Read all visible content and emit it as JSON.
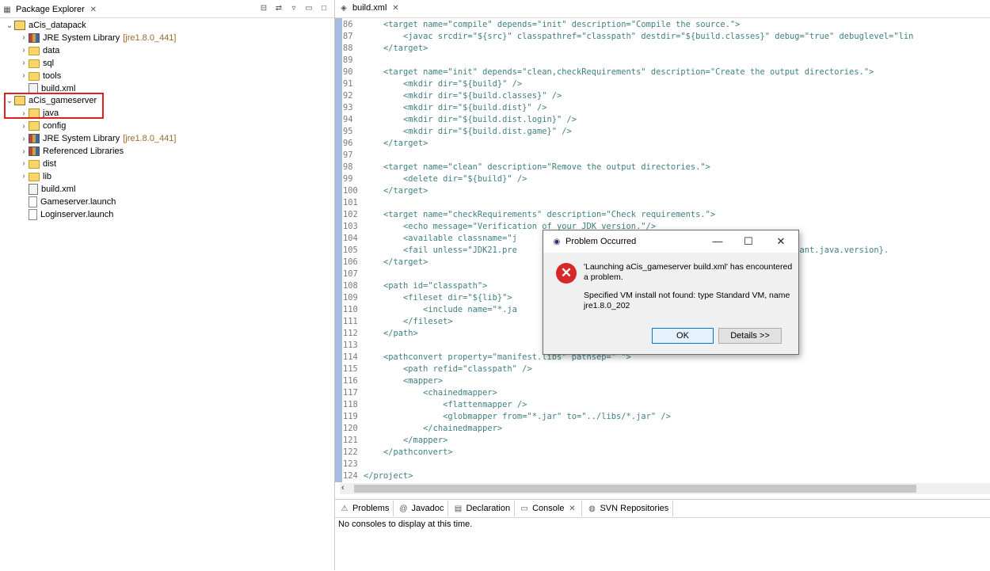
{
  "package_explorer": {
    "title": "Package Explorer",
    "tree": [
      {
        "label": "aCis_datapack",
        "suffix": "",
        "icon": "project-icon"
      },
      {
        "label": "JRE System Library",
        "suffix": "[jre1.8.0_441]",
        "icon": "library-icon"
      },
      {
        "label": "data",
        "suffix": "",
        "icon": "folder-icon"
      },
      {
        "label": "sql",
        "suffix": "",
        "icon": "folder-icon"
      },
      {
        "label": "tools",
        "suffix": "",
        "icon": "folder-icon"
      },
      {
        "label": "build.xml",
        "suffix": "",
        "icon": "ant-file-icon"
      },
      {
        "label": "aCis_gameserver",
        "suffix": "",
        "icon": "project-icon"
      },
      {
        "label": "java",
        "suffix": "",
        "icon": "source-folder-icon"
      },
      {
        "label": "config",
        "suffix": "",
        "icon": "source-folder-icon"
      },
      {
        "label": "JRE System Library",
        "suffix": "[jre1.8.0_441]",
        "icon": "library-icon"
      },
      {
        "label": "Referenced Libraries",
        "suffix": "",
        "icon": "library-icon"
      },
      {
        "label": "dist",
        "suffix": "",
        "icon": "folder-icon"
      },
      {
        "label": "lib",
        "suffix": "",
        "icon": "folder-icon"
      },
      {
        "label": "build.xml",
        "suffix": "",
        "icon": "ant-file-icon"
      },
      {
        "label": "Gameserver.launch",
        "suffix": "",
        "icon": "launch-file-icon"
      },
      {
        "label": "Loginserver.launch",
        "suffix": "",
        "icon": "launch-file-icon"
      }
    ]
  },
  "editor": {
    "tab_label": "build.xml",
    "lines": [
      {
        "n": "86",
        "text": "    <target name=\"compile\" depends=\"init\" description=\"Compile the source.\">"
      },
      {
        "n": "87",
        "text": "        <javac srcdir=\"${src}\" classpathref=\"classpath\" destdir=\"${build.classes}\" debug=\"true\" debuglevel=\"lin"
      },
      {
        "n": "88",
        "text": "    </target>"
      },
      {
        "n": "89",
        "text": ""
      },
      {
        "n": "90",
        "text": "    <target name=\"init\" depends=\"clean,checkRequirements\" description=\"Create the output directories.\">"
      },
      {
        "n": "91",
        "text": "        <mkdir dir=\"${build}\" />"
      },
      {
        "n": "92",
        "text": "        <mkdir dir=\"${build.classes}\" />"
      },
      {
        "n": "93",
        "text": "        <mkdir dir=\"${build.dist}\" />"
      },
      {
        "n": "94",
        "text": "        <mkdir dir=\"${build.dist.login}\" />"
      },
      {
        "n": "95",
        "text": "        <mkdir dir=\"${build.dist.game}\" />"
      },
      {
        "n": "96",
        "text": "    </target>"
      },
      {
        "n": "97",
        "text": ""
      },
      {
        "n": "98",
        "text": "    <target name=\"clean\" description=\"Remove the output directories.\">"
      },
      {
        "n": "99",
        "text": "        <delete dir=\"${build}\" />"
      },
      {
        "n": "100",
        "text": "    </target>"
      },
      {
        "n": "101",
        "text": ""
      },
      {
        "n": "102",
        "text": "    <target name=\"checkRequirements\" description=\"Check requirements.\">"
      },
      {
        "n": "103",
        "text": "        <echo message=\"Verification of your JDK version.\"/>"
      },
      {
        "n": "104",
        "text": "        <available classname=\"j                                         nt\" />"
      },
      {
        "n": "105",
        "text": "        <fail unless=\"JDK21.pre                                         rsion is Java ${ant.java.version}."
      },
      {
        "n": "106",
        "text": "    </target>"
      },
      {
        "n": "107",
        "text": ""
      },
      {
        "n": "108",
        "text": "    <path id=\"classpath\">"
      },
      {
        "n": "109",
        "text": "        <fileset dir=\"${lib}\">"
      },
      {
        "n": "110",
        "text": "            <include name=\"*.ja"
      },
      {
        "n": "111",
        "text": "        </fileset>"
      },
      {
        "n": "112",
        "text": "    </path>"
      },
      {
        "n": "113",
        "text": ""
      },
      {
        "n": "114",
        "text": "    <pathconvert property=\"manifest.libs\" pathsep=\" \">"
      },
      {
        "n": "115",
        "text": "        <path refid=\"classpath\" />"
      },
      {
        "n": "116",
        "text": "        <mapper>"
      },
      {
        "n": "117",
        "text": "            <chainedmapper>"
      },
      {
        "n": "118",
        "text": "                <flattenmapper />"
      },
      {
        "n": "119",
        "text": "                <globmapper from=\"*.jar\" to=\"../libs/*.jar\" />"
      },
      {
        "n": "120",
        "text": "            </chainedmapper>"
      },
      {
        "n": "121",
        "text": "        </mapper>"
      },
      {
        "n": "122",
        "text": "    </pathconvert>"
      },
      {
        "n": "123",
        "text": ""
      },
      {
        "n": "124",
        "text": "</project>"
      }
    ]
  },
  "console": {
    "tabs": [
      {
        "label": "Problems",
        "icon": "problems-icon"
      },
      {
        "label": "Javadoc",
        "icon": "javadoc-icon"
      },
      {
        "label": "Declaration",
        "icon": "declaration-icon"
      },
      {
        "label": "Console",
        "icon": "console-icon"
      },
      {
        "label": "SVN Repositories",
        "icon": "svn-icon"
      }
    ],
    "message": "No consoles to display at this time."
  },
  "dialog": {
    "title": "Problem Occurred",
    "message": "'Launching aCis_gameserver build.xml' has encountered a problem.",
    "detail": "Specified VM install not found: type Standard VM, name jre1.8.0_202",
    "ok_label": "OK",
    "details_label": "Details >>"
  },
  "colors": {
    "highlight_box": "#e32020",
    "error_icon": "#d62828",
    "ok_border": "#0078d7"
  }
}
